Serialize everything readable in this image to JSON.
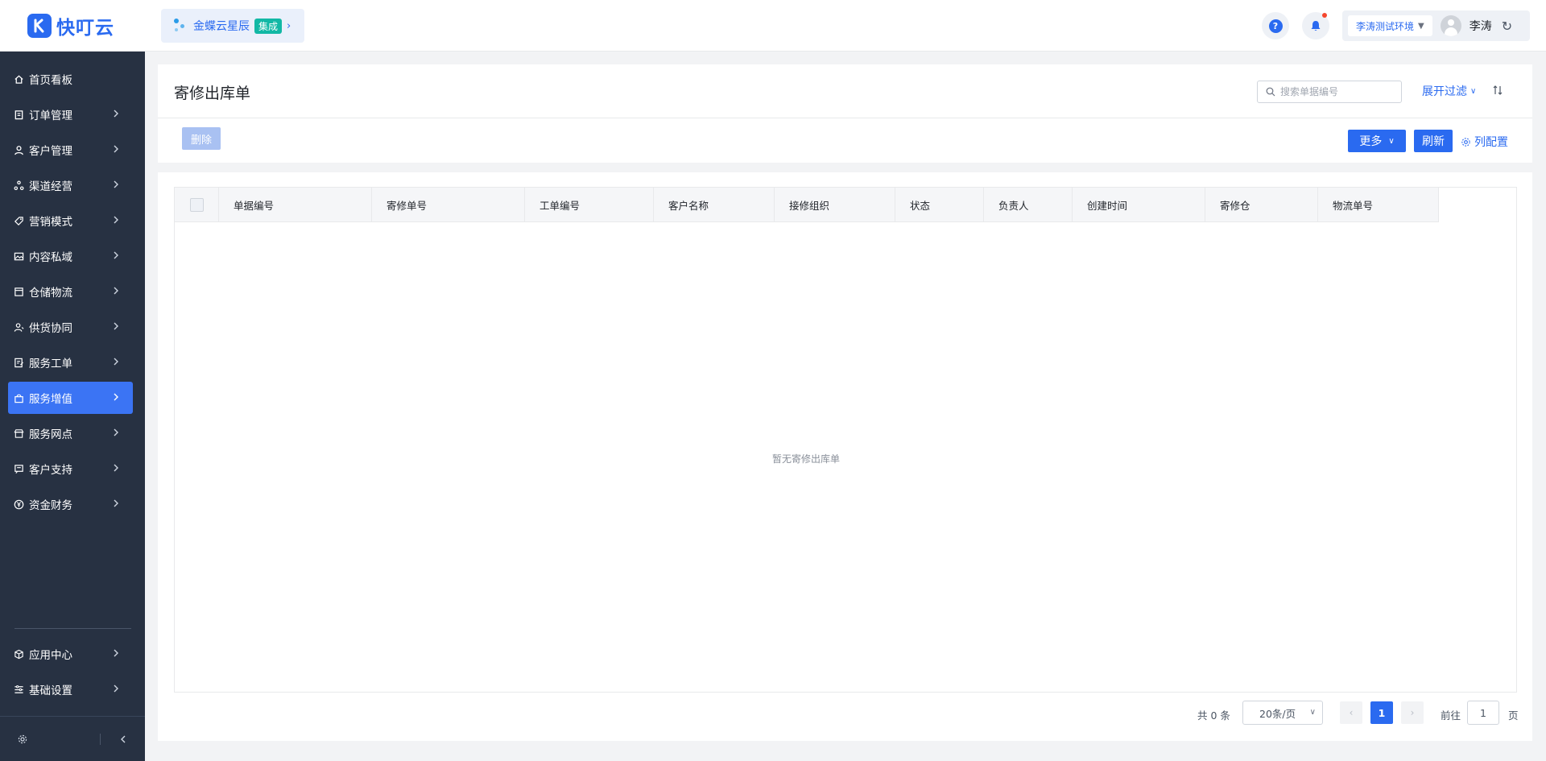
{
  "header": {
    "logo_text": "快叮云",
    "brand_name": "金蝶云星辰",
    "brand_tag": "集成",
    "environment": "李涛测试环境",
    "user_name": "李涛"
  },
  "sidebar": {
    "items": [
      {
        "label": "首页看板",
        "icon": "home-icon",
        "has_arrow": false
      },
      {
        "label": "订单管理",
        "icon": "clipboard-icon",
        "has_arrow": true
      },
      {
        "label": "客户管理",
        "icon": "user-icon",
        "has_arrow": true
      },
      {
        "label": "渠道经营",
        "icon": "channel-icon",
        "has_arrow": true
      },
      {
        "label": "营销模式",
        "icon": "tag-icon",
        "has_arrow": true
      },
      {
        "label": "内容私域",
        "icon": "image-icon",
        "has_arrow": true
      },
      {
        "label": "仓储物流",
        "icon": "warehouse-icon",
        "has_arrow": true
      },
      {
        "label": "供货协同",
        "icon": "supplier-icon",
        "has_arrow": true
      },
      {
        "label": "服务工单",
        "icon": "ticket-icon",
        "has_arrow": true
      },
      {
        "label": "服务增值",
        "icon": "bag-icon",
        "has_arrow": true,
        "active": true
      },
      {
        "label": "服务网点",
        "icon": "store-icon",
        "has_arrow": true
      },
      {
        "label": "客户支持",
        "icon": "support-icon",
        "has_arrow": true
      },
      {
        "label": "资金财务",
        "icon": "yuan-icon",
        "has_arrow": true
      }
    ],
    "bottom_items": [
      {
        "label": "应用中心",
        "icon": "cube-icon",
        "has_arrow": true
      },
      {
        "label": "基础设置",
        "icon": "settings-list-icon",
        "has_arrow": true
      }
    ]
  },
  "page": {
    "title": "寄修出库单",
    "search_placeholder": "搜索单据编号",
    "filter_label": "展开过滤",
    "delete_label": "删除",
    "more_label": "更多",
    "refresh_label": "刷新",
    "column_config_label": "列配置"
  },
  "table": {
    "columns": [
      "单据编号",
      "寄修单号",
      "工单编号",
      "客户名称",
      "接修组织",
      "状态",
      "负责人",
      "创建时间",
      "寄修仓",
      "物流单号"
    ],
    "rows": [],
    "empty_text": "暂无寄修出库单"
  },
  "pagination": {
    "total_text": "共 0 条",
    "page_size": "20条/页",
    "current_page": "1",
    "goto_label": "前往",
    "goto_value": "1",
    "page_suffix": "页"
  },
  "colors": {
    "primary": "#2a6af0",
    "sidebar_bg": "#273142",
    "sidebar_active": "#3b74f4",
    "brand_tag": "#12b8a5",
    "notification_dot": "#f5472e"
  }
}
